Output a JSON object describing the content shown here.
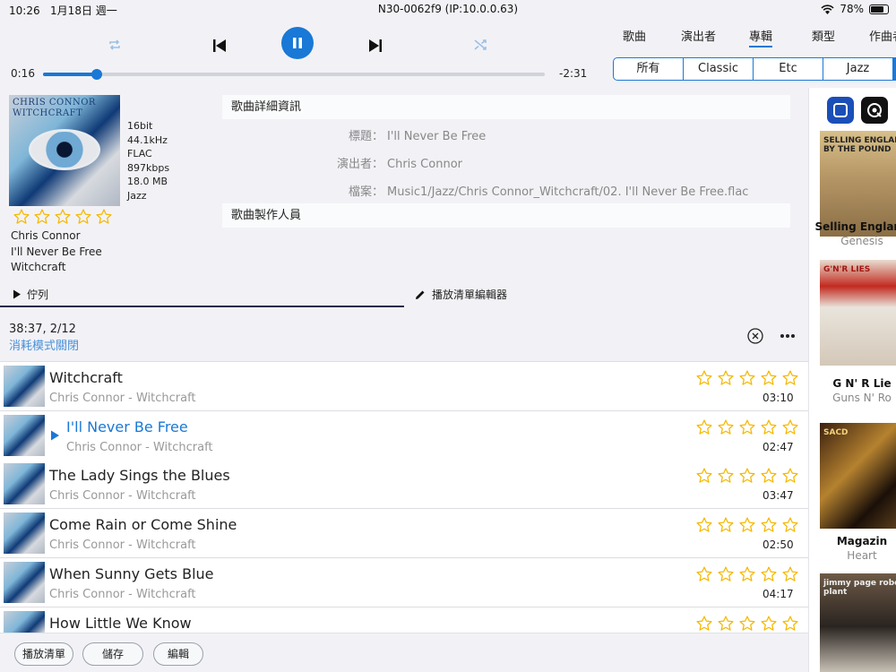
{
  "status_bar": {
    "time": "10:26",
    "date": "1月18日 週一",
    "device": "N30-0062f9 (IP:10.0.0.63)",
    "battery": "78%",
    "battery_level": 0.78
  },
  "player": {
    "elapsed": "0:16",
    "remaining": "-2:31",
    "progress": 0.107
  },
  "nav": {
    "tabs": [
      "歌曲",
      "演出者",
      "專輯",
      "類型",
      "作曲者"
    ],
    "active": "專輯"
  },
  "filter": {
    "segments": [
      "所有",
      "Classic",
      "Etc",
      "Jazz"
    ]
  },
  "now_playing": {
    "album_cover_text": [
      "CHRIS CONNOR",
      "WITCHCRAFT"
    ],
    "bit_depth": "16bit",
    "sample_rate": "44.1kHz",
    "format": "FLAC",
    "bitrate": "897kbps",
    "size": "18.0 MB",
    "genre": "Jazz",
    "artist": "Chris Connor",
    "title": "I'll Never Be Free",
    "album": "Witchcraft",
    "rating": 0
  },
  "details": {
    "section_title": "歌曲詳細資訊",
    "title_label": "標題：",
    "title_value": "I'll Never Be Free",
    "artist_label": "演出者：",
    "artist_value": "Chris Connor",
    "file_label": "檔案：",
    "file_value": "Music1/Jazz/Chris Connor_Witchcraft/02. I'll Never Be Free.flac",
    "credits_title": "歌曲製作人員"
  },
  "subtabs": {
    "queue": "佇列",
    "playlist_editor": "播放清單編輯器"
  },
  "queue": {
    "summary": "38:37, 2/12",
    "consume_mode": "消耗模式關閉"
  },
  "tracks": [
    {
      "title": "Witchcraft",
      "sub": "Chris Connor - Witchcraft",
      "duration": "03:10",
      "current": false,
      "rating": 0
    },
    {
      "title": "I'll Never Be Free",
      "sub": "Chris Connor - Witchcraft",
      "duration": "02:47",
      "current": true,
      "rating": 0
    },
    {
      "title": "The Lady Sings the Blues",
      "sub": "Chris Connor - Witchcraft",
      "duration": "03:47",
      "current": false,
      "rating": 0
    },
    {
      "title": "Come Rain or Come Shine",
      "sub": "Chris Connor - Witchcraft",
      "duration": "02:50",
      "current": false,
      "rating": 0
    },
    {
      "title": "When Sunny Gets Blue",
      "sub": "Chris Connor - Witchcraft",
      "duration": "04:17",
      "current": false,
      "rating": 0
    },
    {
      "title": "How Little We Know",
      "sub": "",
      "duration": "",
      "current": false,
      "rating": 0
    }
  ],
  "bottom_buttons": {
    "playlist": "播放清單",
    "save": "儲存",
    "edit": "編輯"
  },
  "albums": [
    {
      "title": "Selling England",
      "artist": "Genesis",
      "cover_text": "SELLING ENGLAND BY THE POUND"
    },
    {
      "title": "G N' R Lie",
      "artist": "Guns N' Ro",
      "cover_text": "G'N'R LIES"
    },
    {
      "title": "Magazin",
      "artist": "Heart",
      "cover_text": "SACD"
    },
    {
      "title": "",
      "artist": "",
      "cover_text": "jimmy page robert plant"
    }
  ],
  "colors": {
    "accent": "#1a78d6",
    "star": "#f5b800",
    "muted": "#999999"
  }
}
